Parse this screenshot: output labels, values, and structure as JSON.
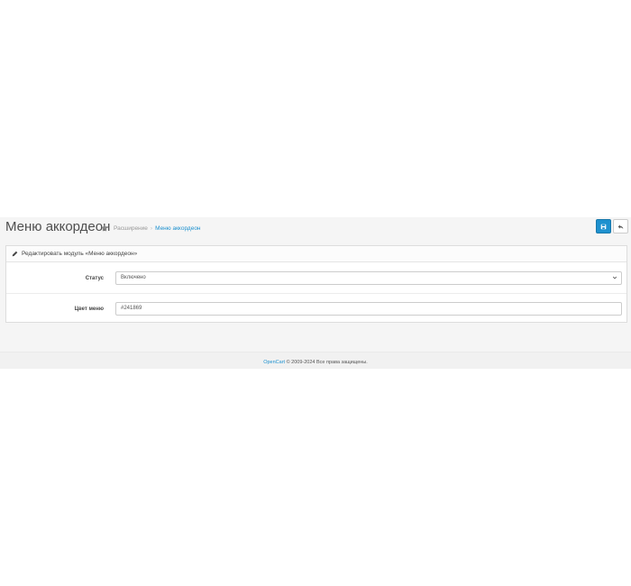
{
  "header": {
    "title": "Меню аккордеон",
    "breadcrumb": {
      "home_icon": "home-icon",
      "items": [
        "Расширение",
        "Меню аккордеон"
      ]
    },
    "buttons": {
      "save_icon": "save-icon",
      "back_icon": "reply-icon"
    }
  },
  "panel": {
    "heading_icon": "pencil-icon",
    "heading": "Редактировать модуль «Меню аккордеон»",
    "fields": {
      "status": {
        "label": "Статус",
        "value": "Включено"
      },
      "color": {
        "label": "Цвет меню",
        "value": "#241869"
      }
    }
  },
  "footer": {
    "link": "OpenCart",
    "text": " © 2009-2024 Все права защищены."
  },
  "colors": {
    "primary": "#1e91cf",
    "page_background": "#f5f5f5"
  }
}
